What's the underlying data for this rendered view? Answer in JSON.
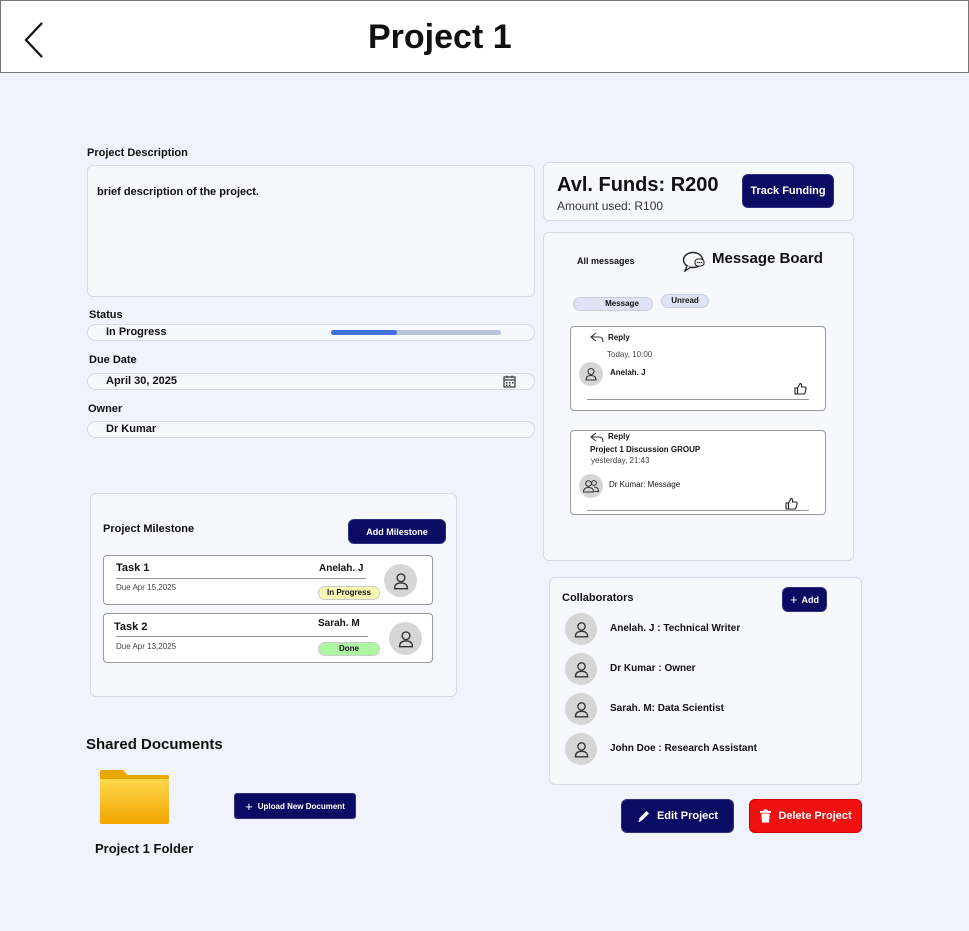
{
  "header": {
    "title": "Project 1"
  },
  "description": {
    "label": "Project Description",
    "text": "brief description of the project."
  },
  "status": {
    "label": "Status",
    "value": "In Progress",
    "progress": 0.39
  },
  "due_date": {
    "label": "Due Date",
    "value": "April 30, 2025"
  },
  "owner": {
    "label": "Owner",
    "value": "Dr Kumar"
  },
  "funds": {
    "available": "Avl. Funds: R200",
    "used": "Amount used: R100",
    "track_button": "Track Funding"
  },
  "message_board": {
    "all_messages": "All messages",
    "title": "Message Board",
    "filters": [
      "Message",
      "Unread"
    ],
    "messages": [
      {
        "reply": "Reply",
        "time": "Today, 10:00",
        "author": "Anelah. J"
      },
      {
        "reply": "Reply",
        "group": "Project 1 Discussion GROUP",
        "time": "yesterday, 21:43",
        "author": "Dr Kumar:  Message"
      }
    ]
  },
  "milestones": {
    "title": "Project Milestone",
    "add_button": "Add Milestone",
    "tasks": [
      {
        "name": "Task 1",
        "due": "Due Apr 15,2025",
        "assignee": "Anelah. J",
        "status": "In Progress",
        "status_color": "#f8f7b4"
      },
      {
        "name": "Task 2",
        "due": "Due Apr 13,2025",
        "assignee": "Sarah. M",
        "status": "Done",
        "status_color": "#adf7a3"
      }
    ]
  },
  "collaborators": {
    "title": "Collaborators",
    "add_button": "Add",
    "people": [
      "Anelah. J : Technical Writer",
      "Dr Kumar : Owner",
      "Sarah. M: Data Scientist",
      "John Doe : Research Assistant"
    ]
  },
  "documents": {
    "title": "Shared Documents",
    "folder": "Project 1 Folder",
    "upload_button": "Upload New Document"
  },
  "actions": {
    "edit": "Edit Project",
    "delete": "Delete Project"
  },
  "colors": {
    "primary": "#0b0b63",
    "danger": "#f01010",
    "background": "#f0f2fc",
    "progress": "#3f6fd9"
  }
}
